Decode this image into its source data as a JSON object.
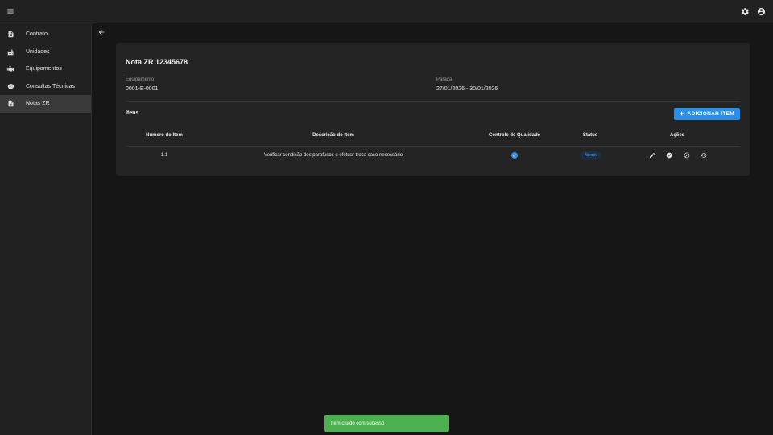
{
  "topbar": {
    "menu_icon": "menu-icon",
    "settings_icon": "gear-icon",
    "account_icon": "account-circle-icon"
  },
  "sidebar": {
    "items": [
      {
        "label": "Contrato",
        "icon": "document-icon"
      },
      {
        "label": "Unidades",
        "icon": "factory-icon"
      },
      {
        "label": "Equipamentos",
        "icon": "engine-icon"
      },
      {
        "label": "Consultas Técnicas",
        "icon": "chat-bubble-icon"
      },
      {
        "label": "Notas ZR",
        "icon": "note-icon",
        "active": true
      }
    ]
  },
  "page": {
    "title": "Nota ZR 12345678",
    "equipment_label": "Equipamento",
    "equipment_value": "0001-E-0001",
    "stop_label": "Parada",
    "stop_value": "27/01/2026 - 30/01/2026",
    "items_title": "Itens",
    "add_button_label": "ADICIONAR ITEM"
  },
  "table": {
    "columns": [
      "Número do Item",
      "Descrição do Item",
      "Controle de Qualidade",
      "Status",
      "Ações"
    ],
    "rows": [
      {
        "number": "1.1",
        "description": "Verificar condição dos parafusos e efetuar troca caso necessário",
        "quality_control": true,
        "status": "Aberto",
        "actions": [
          "pencil-icon",
          "check-circle-icon",
          "block-icon",
          "history-icon"
        ]
      }
    ]
  },
  "snackbar": {
    "message": "Item criado com sucesso"
  },
  "colors": {
    "accent": "#2a8fe6",
    "success": "#4caf50",
    "status_badge_text": "#4b9ef0"
  }
}
